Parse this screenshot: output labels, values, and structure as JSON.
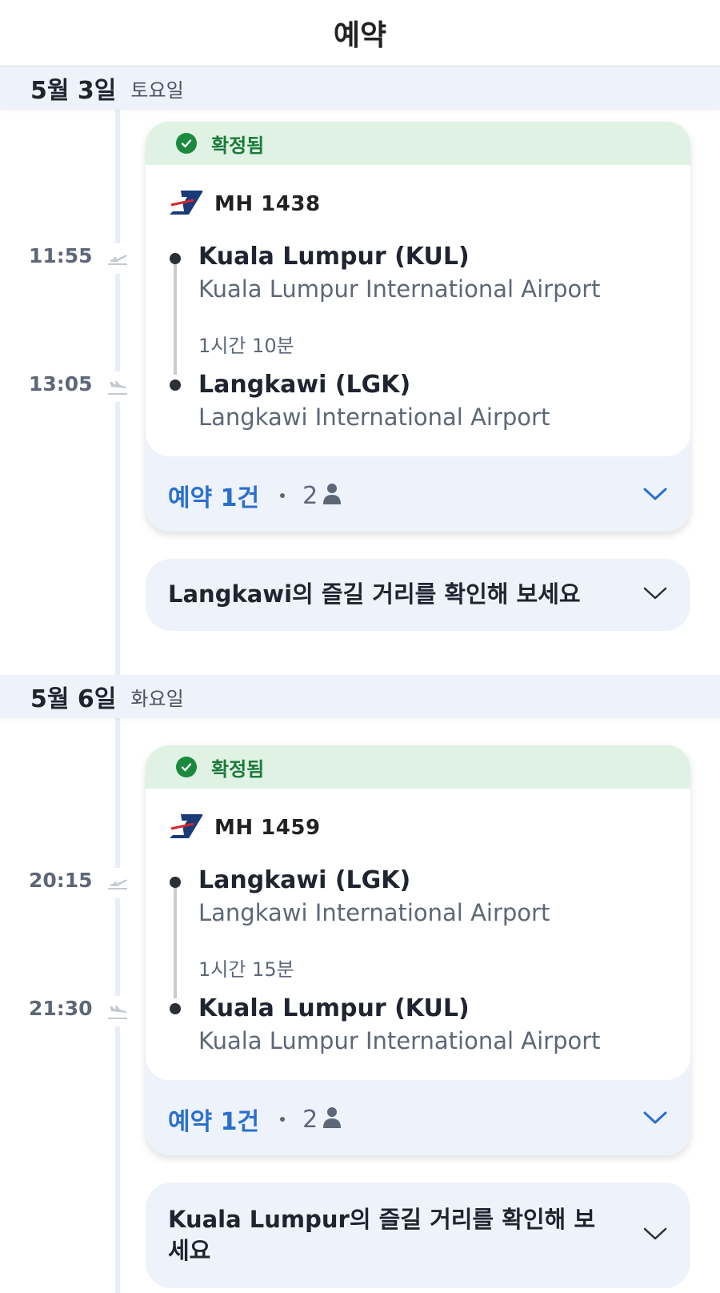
{
  "header": {
    "title": "예약"
  },
  "days": [
    {
      "date": "5월 3일",
      "weekday": "토요일",
      "status": "확정됨",
      "flight_number": "MH 1438",
      "departure": {
        "time": "11:55",
        "city": "Kuala Lumpur (KUL)",
        "airport": "Kuala Lumpur International Airport"
      },
      "duration": "1시간 10분",
      "arrival": {
        "time": "13:05",
        "city": "Langkawi (LGK)",
        "airport": "Langkawi International Airport"
      },
      "booking_label": "예약 1건",
      "passengers": "2",
      "explore_text": "Langkawi의 즐길 거리를 확인해 보세요"
    },
    {
      "date": "5월 6일",
      "weekday": "화요일",
      "status": "확정됨",
      "flight_number": "MH 1459",
      "departure": {
        "time": "20:15",
        "city": "Langkawi (LGK)",
        "airport": "Langkawi International Airport"
      },
      "duration": "1시간 15분",
      "arrival": {
        "time": "21:30",
        "city": "Kuala Lumpur (KUL)",
        "airport": "Kuala Lumpur International Airport"
      },
      "booking_label": "예약 1건",
      "passengers": "2",
      "explore_text": "Kuala Lumpur의 즐길 거리를 확인해 보세요"
    }
  ],
  "icons": {
    "status": "check-circle-icon",
    "airline": "malaysia-airlines-logo",
    "departure": "plane-takeoff-icon",
    "arrival": "plane-landing-icon",
    "passengers": "person-icon",
    "expand": "chevron-down-icon"
  },
  "colors": {
    "confirmed_bg": "#dff2e3",
    "confirmed_text": "#1a7a3a",
    "accent_blue": "#2a6fce",
    "card_bg": "#eef3fb",
    "airline_navy": "#1b3a78"
  }
}
